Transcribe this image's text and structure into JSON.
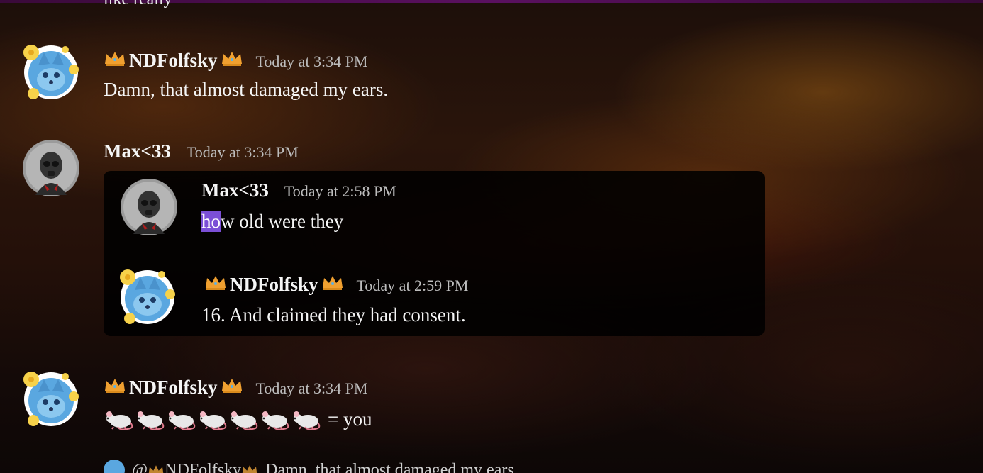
{
  "previous_message_fragment": "like really",
  "messages": [
    {
      "author": "NDFolfsky",
      "timestamp": "Today at 3:34 PM",
      "text": "Damn, that almost damaged my ears."
    },
    {
      "author": "Max<33",
      "timestamp": "Today at 3:34 PM",
      "quoted": [
        {
          "author": "Max<33",
          "timestamp": "Today at 2:58 PM",
          "text_highlight": "ho",
          "text_rest": "w old were they"
        },
        {
          "author": "NDFolfsky",
          "timestamp": "Today at 2:59 PM",
          "text": "16. And claimed they had consent."
        }
      ]
    },
    {
      "author": "NDFolfsky",
      "timestamp": "Today at 3:34 PM",
      "emoji": [
        "rat-emoji",
        "rat-emoji",
        "rat-emoji",
        "rat-emoji",
        "rat-emoji",
        "rat-emoji",
        "rat-emoji"
      ],
      "text": "= you"
    }
  ],
  "reply_preview": {
    "mention": "@",
    "author": "NDFolfsky",
    "text": "Damn, that almost damaged my ears."
  },
  "colors": {
    "highlight": "#7b4fd6",
    "avatar_fox_blue": "#5aa7e0",
    "crown_gold": "#f0a030"
  },
  "icons": {
    "crown": "crown-icon",
    "fox_avatar": "fox-avatar",
    "masked_avatar": "masked-figure-avatar"
  }
}
